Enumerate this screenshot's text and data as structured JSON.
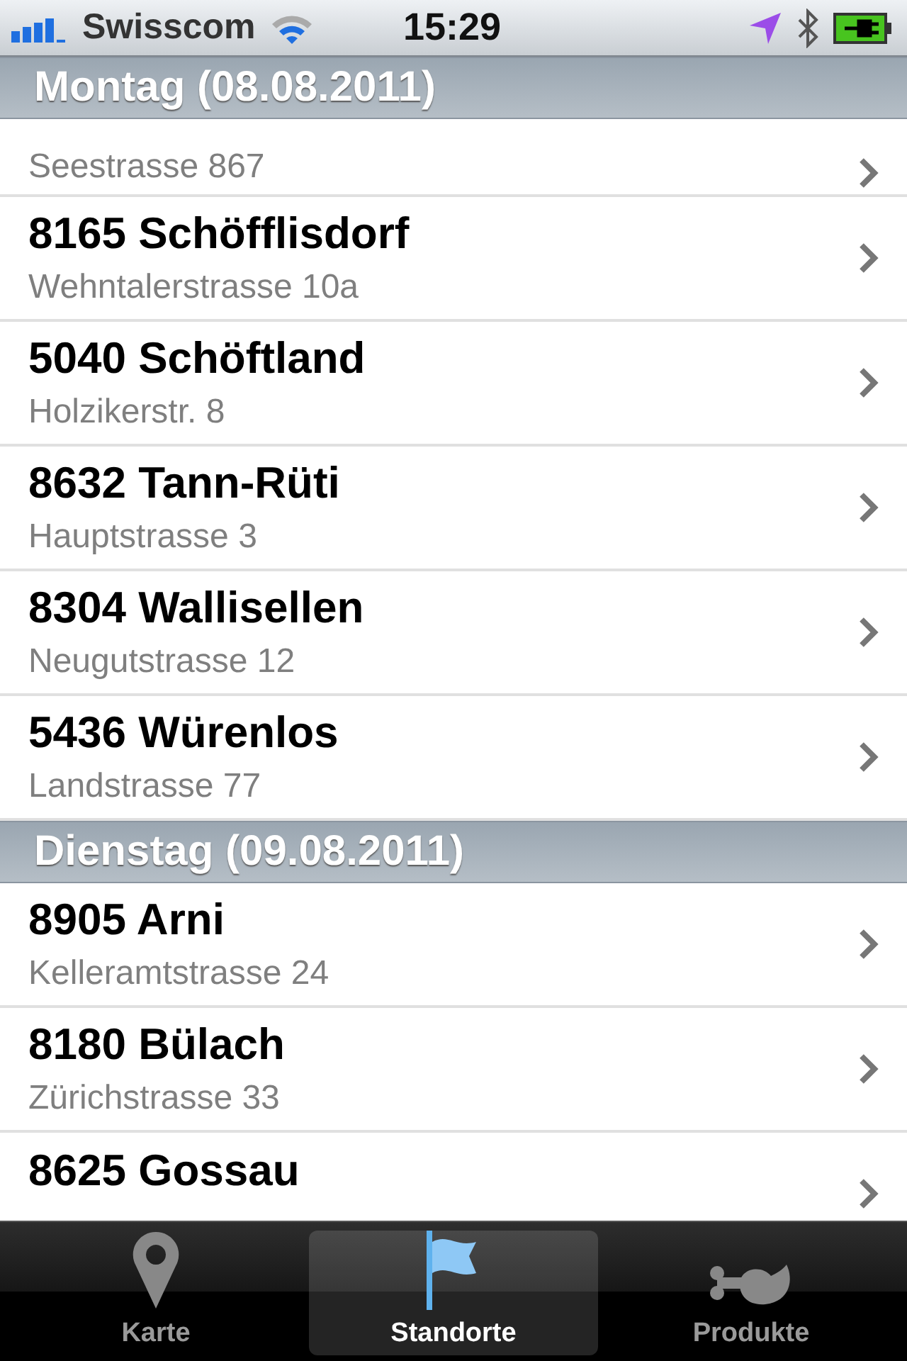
{
  "status_bar": {
    "carrier": "Swisscom",
    "time": "15:29"
  },
  "sections": [
    {
      "header": "Montag (08.08.2011)",
      "rows": [
        {
          "subtitle": "Seestrasse 867"
        },
        {
          "title": "8165 Schöfflisdorf",
          "subtitle": "Wehntalerstrasse 10a"
        },
        {
          "title": "5040 Schöftland",
          "subtitle": "Holzikerstr. 8"
        },
        {
          "title": "8632 Tann-Rüti",
          "subtitle": "Hauptstrasse 3"
        },
        {
          "title": "8304 Wallisellen",
          "subtitle": "Neugutstrasse 12"
        },
        {
          "title": "5436 Würenlos",
          "subtitle": "Landstrasse 77"
        }
      ]
    },
    {
      "header": "Dienstag (09.08.2011)",
      "rows": [
        {
          "title": "8905 Arni",
          "subtitle": "Kelleramtstrasse 24"
        },
        {
          "title": "8180 Bülach",
          "subtitle": "Zürichstrasse 33"
        },
        {
          "title": "8625 Gossau"
        }
      ]
    }
  ],
  "tab_bar": [
    {
      "kind": "pin",
      "label": "Karte",
      "selected": false
    },
    {
      "kind": "flag",
      "label": "Standorte",
      "selected": true
    },
    {
      "kind": "meat",
      "label": "Produkte",
      "selected": false
    }
  ]
}
